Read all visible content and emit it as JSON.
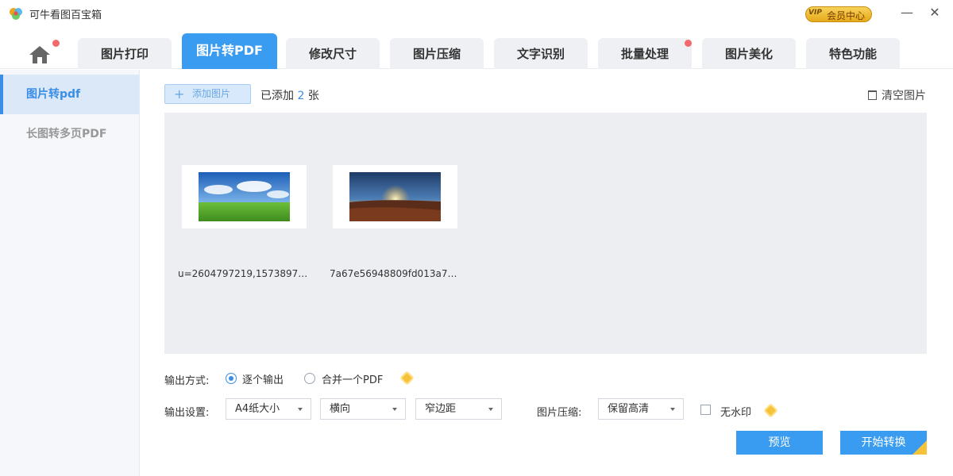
{
  "titlebar": {
    "app_title": "可牛看图百宝箱",
    "vip_tag": "VIP",
    "vip_label": "会员中心",
    "minimize": "—",
    "close": "✕"
  },
  "tabs": [
    {
      "label": "图片打印",
      "active": false
    },
    {
      "label": "图片转PDF",
      "active": true
    },
    {
      "label": "修改尺寸",
      "active": false
    },
    {
      "label": "图片压缩",
      "active": false
    },
    {
      "label": "文字识别",
      "active": false
    },
    {
      "label": "批量处理",
      "active": false,
      "badge": true
    },
    {
      "label": "图片美化",
      "active": false
    },
    {
      "label": "特色功能",
      "active": false
    }
  ],
  "sidebar": {
    "items": [
      {
        "label": "图片转pdf",
        "active": true
      },
      {
        "label": "长图转多页PDF",
        "active": false
      }
    ]
  },
  "toolbar": {
    "add_icon": "+",
    "add_label": "添加图片",
    "added_prefix": "已添加 ",
    "added_count": "2",
    "added_suffix": " 张",
    "clear_label": "清空图片"
  },
  "images": [
    {
      "filename": "u=2604797219,1573897…",
      "scene": "blue-sky-grassland"
    },
    {
      "filename": "7a67e56948809fd013a7…",
      "scene": "sunset-field"
    }
  ],
  "output_mode": {
    "label": "输出方式:",
    "options": [
      {
        "label": "逐个输出",
        "selected": true
      },
      {
        "label": "合并一个PDF",
        "selected": false
      }
    ]
  },
  "output_settings": {
    "label": "输出设置:",
    "paper": "A4纸大小",
    "orientation": "横向",
    "margin": "窄边距",
    "compress_label": "图片压缩:",
    "compress": "保留高清",
    "watermark_label": "无水印",
    "watermark_checked": false
  },
  "actions": {
    "preview": "预览",
    "start": "开始转换"
  },
  "colors": {
    "accent": "#3a9cf1",
    "badge": "#f36a6a",
    "vip_gold": "#f5c23a"
  }
}
